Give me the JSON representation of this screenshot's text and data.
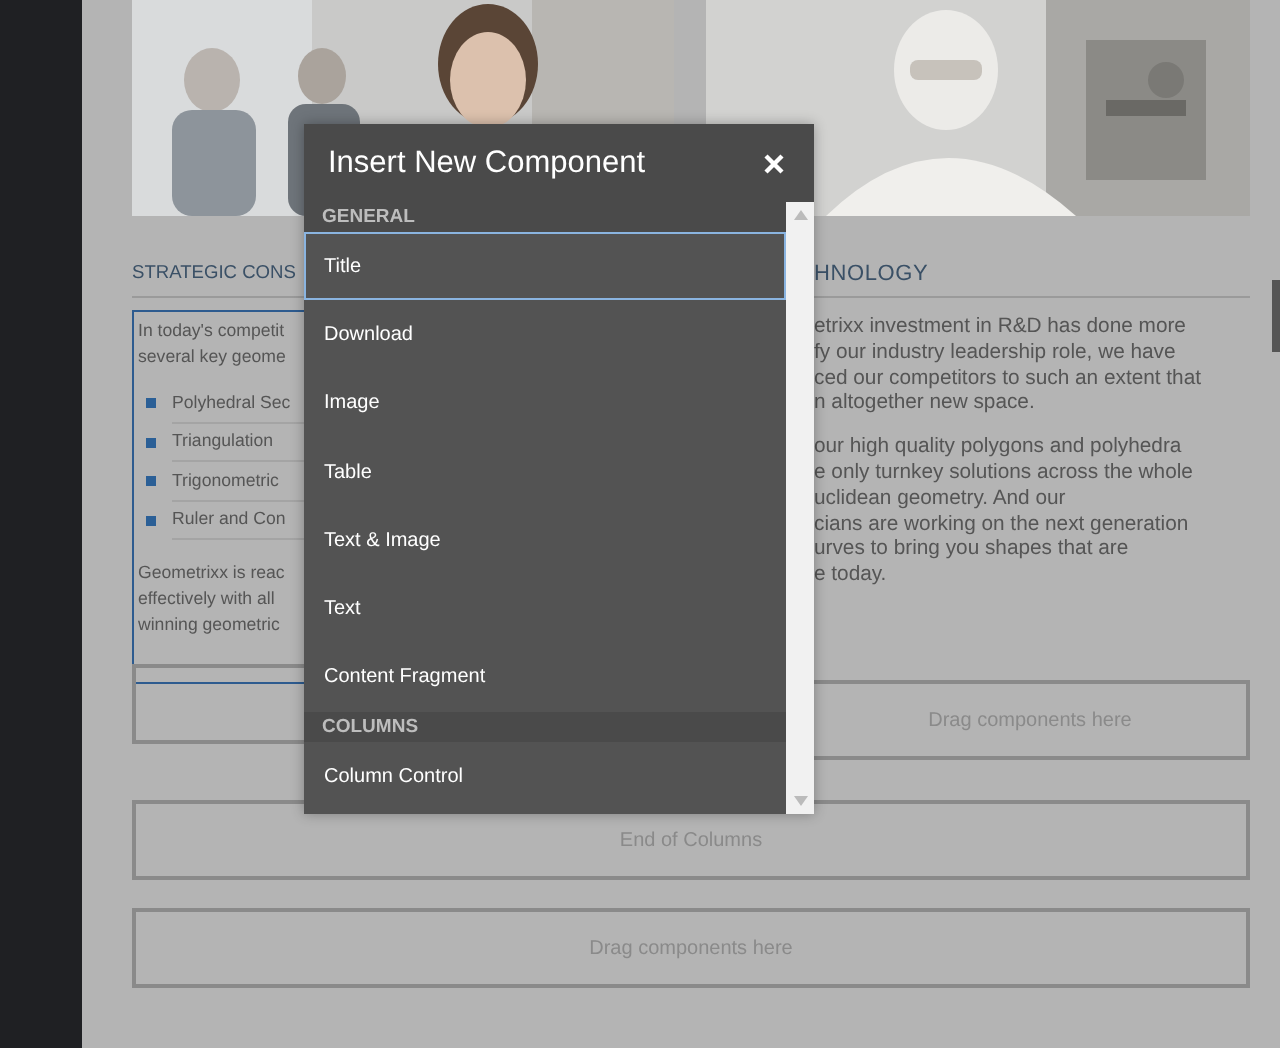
{
  "page": {
    "left_column": {
      "heading": "STRATEGIC CONS",
      "intro": [
        "In today's competit",
        "several key geome"
      ],
      "bullets": [
        "Polyhedral Sec",
        "Triangulation",
        "Trigonometric",
        "Ruler and Con"
      ],
      "outro": [
        "Geometrixx is reac",
        "effectively with all",
        "winning geometric"
      ]
    },
    "right_column": {
      "heading": "HNOLOGY",
      "paragraphs": [
        [
          "etrixx investment in R&D has done more",
          "fy our industry leadership role, we have",
          "ced our competitors to such an extent that",
          "n altogether new space."
        ],
        [
          "our high quality polygons and polyhedra",
          "e only turnkey solutions across the whole",
          "uclidean geometry. And our",
          "cians are working on the next generation",
          "urves to bring you shapes that are",
          "e today."
        ]
      ]
    },
    "column_drop_zone": "Drag components here",
    "drop_zones": [
      "End of Columns",
      "Drag components here"
    ]
  },
  "dialog": {
    "title": "Insert New Component",
    "groups": [
      {
        "label": "GENERAL",
        "items": [
          {
            "label": "Title",
            "selected": true
          },
          {
            "label": "Download",
            "selected": false
          },
          {
            "label": "Image",
            "selected": false
          },
          {
            "label": "Table",
            "selected": false
          },
          {
            "label": "Text & Image",
            "selected": false
          },
          {
            "label": "Text",
            "selected": false
          },
          {
            "label": "Content Fragment",
            "selected": false
          }
        ]
      },
      {
        "label": "COLUMNS",
        "items": [
          {
            "label": "Column Control",
            "selected": false
          }
        ]
      }
    ]
  }
}
